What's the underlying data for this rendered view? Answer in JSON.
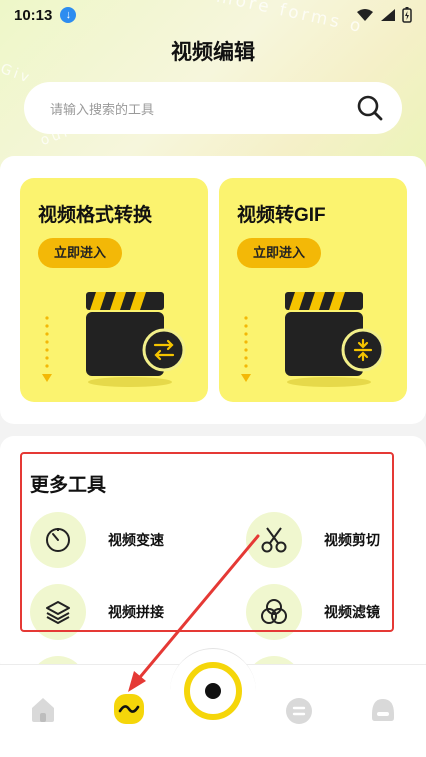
{
  "status": {
    "time": "10:13"
  },
  "header": {
    "title": "视频编辑",
    "decor_text": "more forms o",
    "decor_text2": "Giv",
    "decor_text3": "our"
  },
  "search": {
    "placeholder": "请输入搜索的工具"
  },
  "featured": [
    {
      "title": "视频格式转换",
      "button": "立即进入",
      "badge_icon": "swap-arrows-icon"
    },
    {
      "title": "视频转GIF",
      "button": "立即进入",
      "badge_icon": "compress-icon"
    }
  ],
  "more_tools": {
    "title": "更多工具",
    "items": [
      {
        "label": "视频变速",
        "icon": "speed-dial-icon"
      },
      {
        "label": "视频剪切",
        "icon": "scissors-icon"
      },
      {
        "label": "视频拼接",
        "icon": "layers-icon"
      },
      {
        "label": "视频滤镜",
        "icon": "filter-circles-icon"
      }
    ]
  },
  "tabbar": {
    "items": [
      "home-icon",
      "wave-icon",
      "record-icon",
      "list-icon",
      "profile-icon"
    ],
    "active_color": "#f5d60a"
  },
  "colors": {
    "card_yellow": "#fbf36f",
    "button_yellow": "#f3b807",
    "annotation_red": "#e53935"
  }
}
